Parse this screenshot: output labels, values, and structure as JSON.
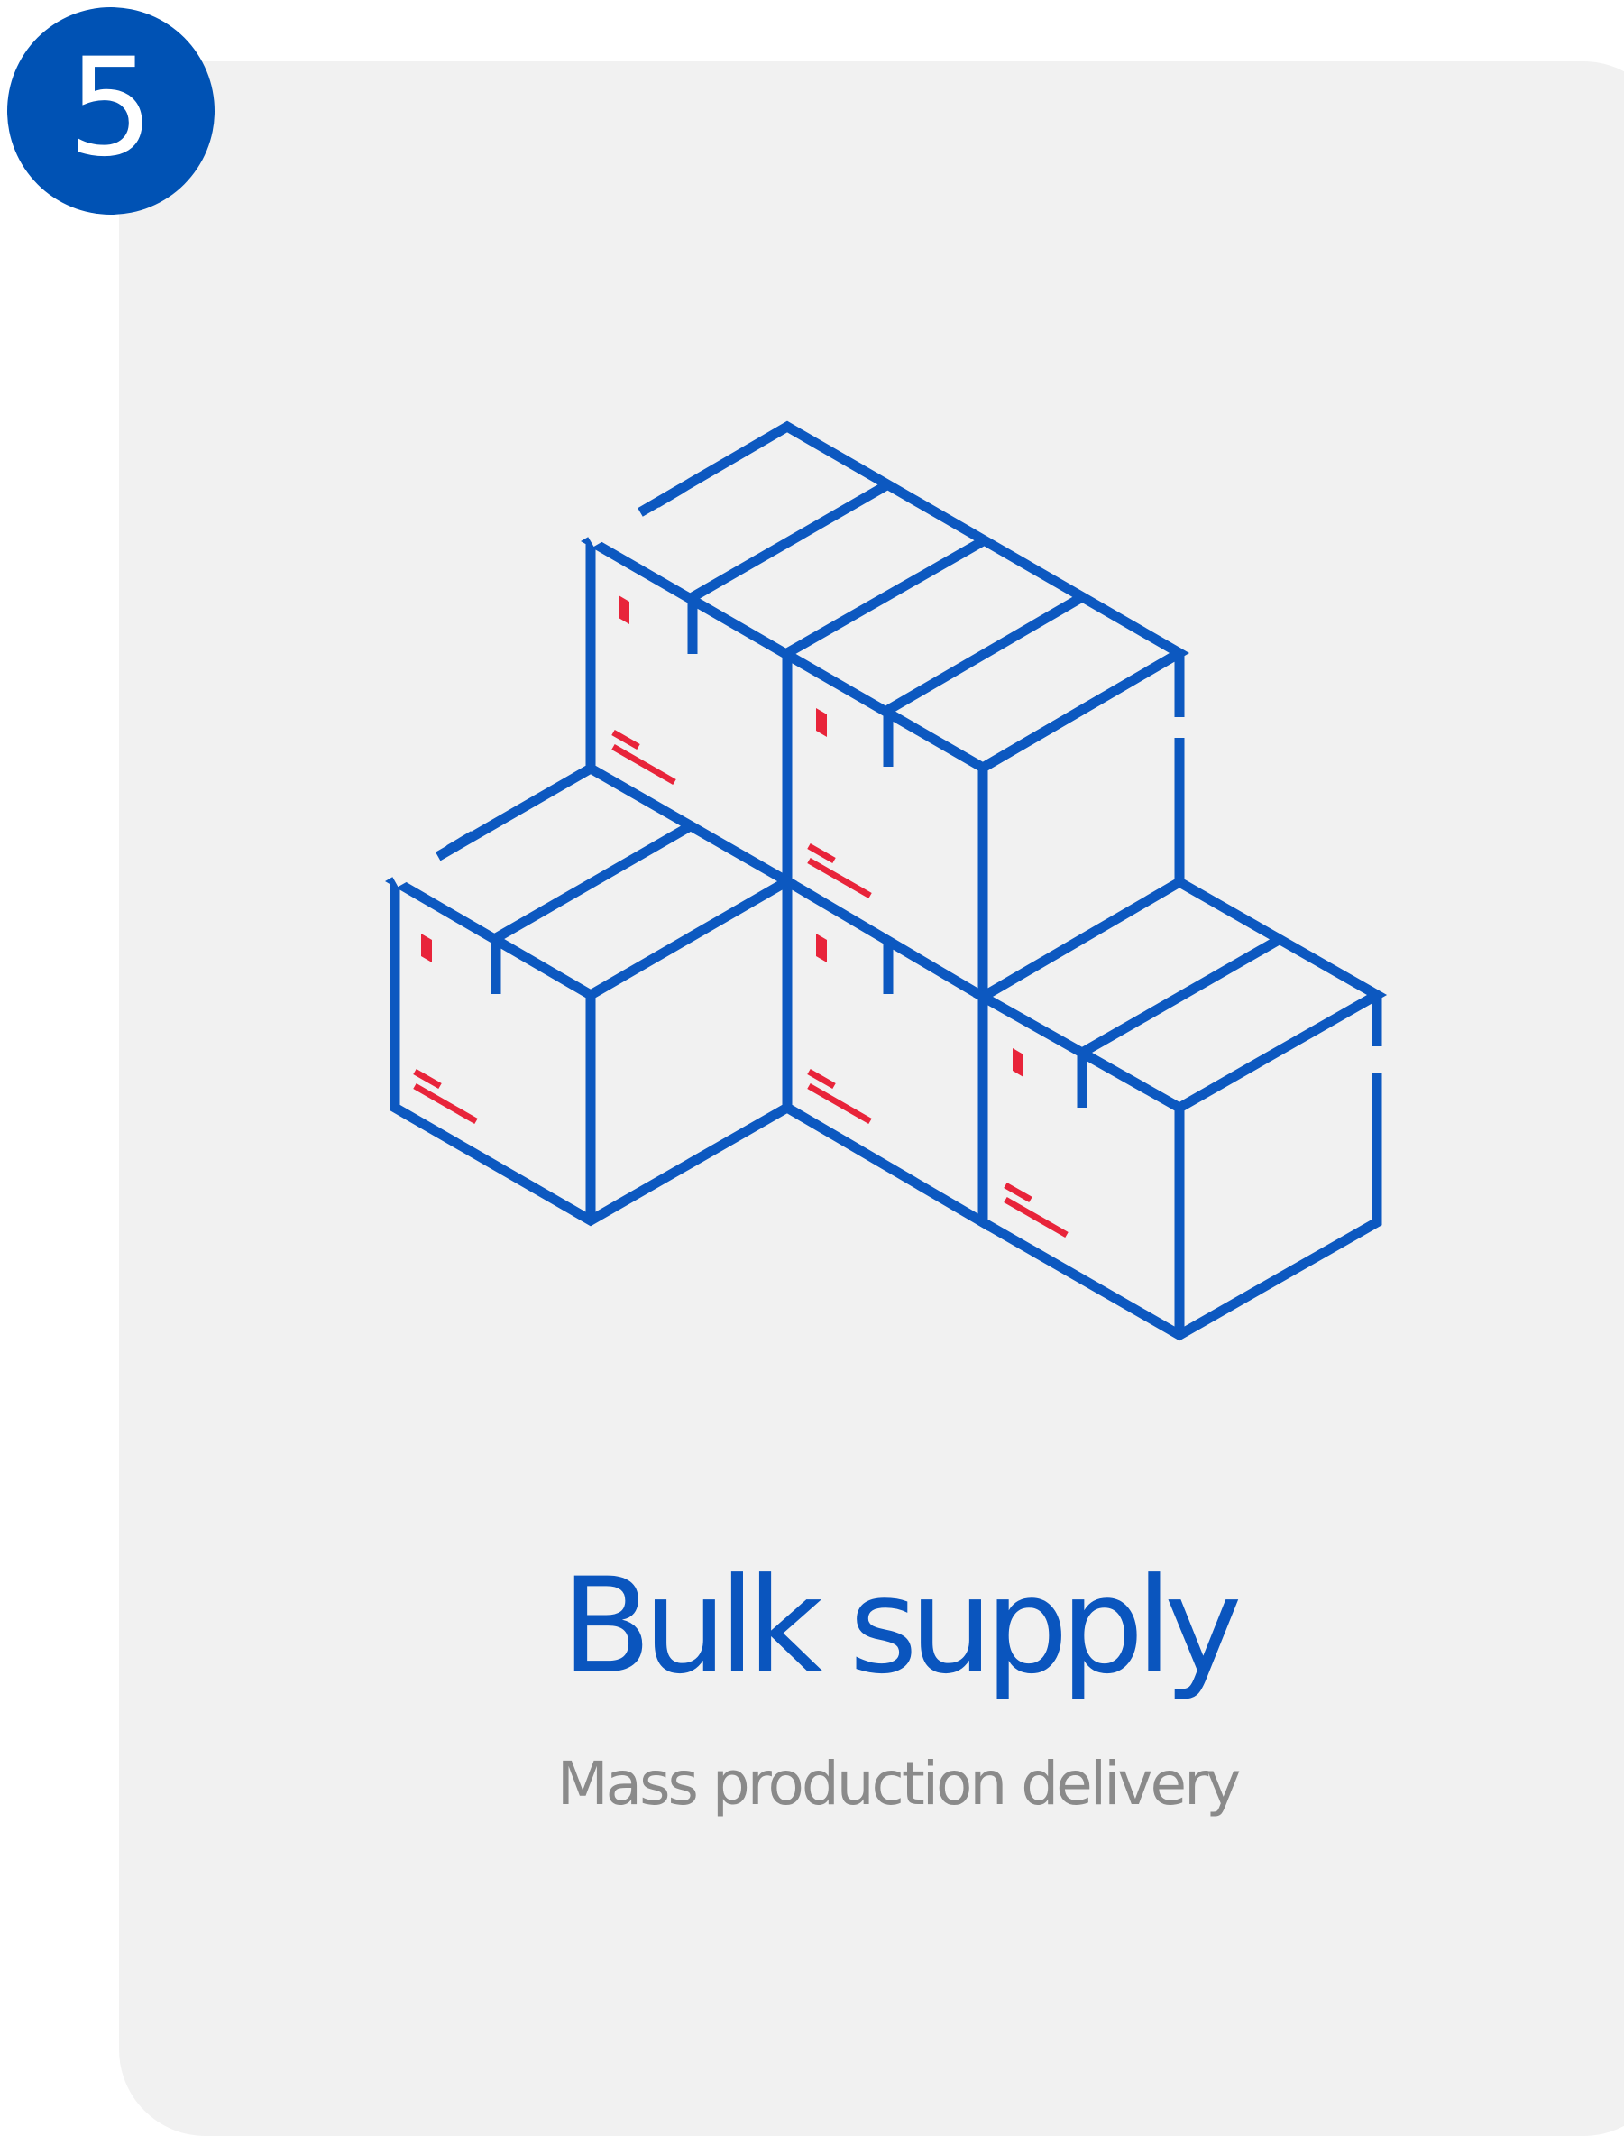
{
  "step": {
    "number": "5"
  },
  "card": {
    "title": "Bulk supply",
    "subtitle": "Mass production delivery",
    "illustration_icon": "stacked-boxes-icon"
  },
  "colors": {
    "badge": "#0052b4",
    "card_background": "#f1f1f1",
    "title": "#0a55be",
    "subtitle": "#8a8a8a",
    "line_art": "#0c58c0",
    "accent": "#e8243a"
  }
}
